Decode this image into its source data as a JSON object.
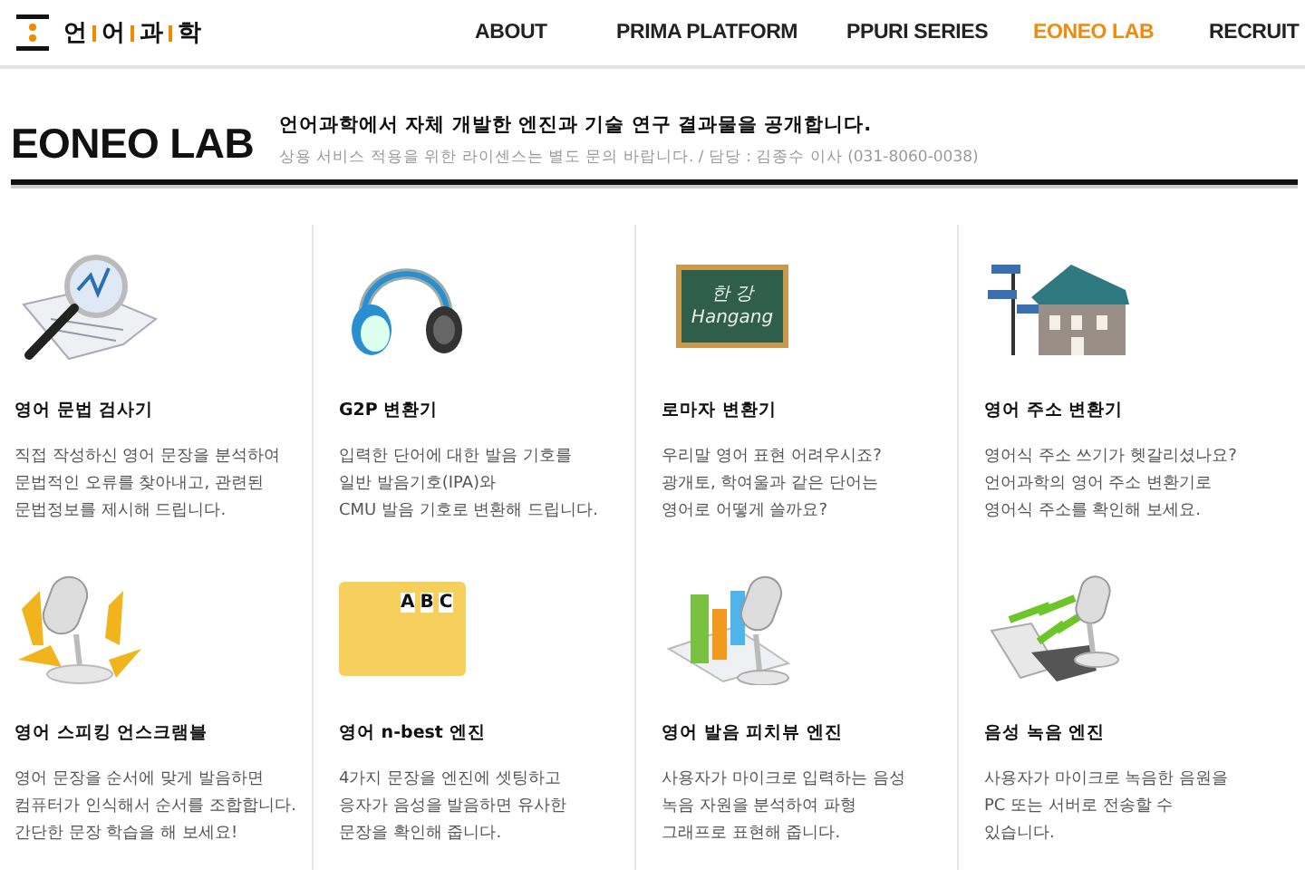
{
  "logo": {
    "syllables": [
      "언",
      "어",
      "과",
      "학"
    ]
  },
  "nav": [
    {
      "label": "ABOUT",
      "selected": false
    },
    {
      "label": "PRIMA PLATFORM",
      "selected": false
    },
    {
      "label": "PPURI SERIES",
      "selected": false
    },
    {
      "label": "EONEO LAB",
      "selected": true
    },
    {
      "label": "RECRUIT",
      "selected": false
    }
  ],
  "page_header": {
    "title": "EONEO LAB",
    "subtitle": "언어과학에서 자체 개발한 엔진과 기술 연구 결과물을 공개합니다.",
    "note": "상용 서비스 적용을 위한 라이센스는 별도 문의 바랍니다. / 담당 : 김종수 이사 (031-8060-0038)"
  },
  "products": [
    {
      "kind": "magnifier",
      "title": "영어 문법 검사기",
      "description": "직접 작성하신 영어 문장을 분석하여\n문법적인 오류를 찾아내고, 관련된\n문법정보를 제시해 드립니다."
    },
    {
      "kind": "headphones",
      "title": "G2P 변환기",
      "description": "입력한 단어에 대한 발음 기호를\n일반 발음기호(IPA)와\nCMU 발음 기호로 변환해 드립니다."
    },
    {
      "kind": "chalkboard",
      "board_text": [
        "한 강",
        "Hangang"
      ],
      "title": "로마자 변환기",
      "description": "우리말 영어 표현 어려우시죠?\n광개토, 학여울과 같은 단어는\n영어로 어떻게 쓸까요?"
    },
    {
      "kind": "house",
      "title": "영어 주소 변환기",
      "description": "영어식 주소 쓰기가 헷갈리셨나요?\n언어과학의 영어 주소 변환기로\n영어식 주소를 확인해 보세요."
    },
    {
      "kind": "mic_arrows",
      "title": "영어 스피킹 언스크램블",
      "description": "영어 문장을 순서에 맞게 발음하면\n컴퓨터가 인식해서 순서를 조합합니다.\n간단한 문장 학습을 해 보세요!"
    },
    {
      "kind": "folder",
      "board_text": [
        "A",
        "B",
        "C"
      ],
      "title": "영어 n-best 엔진",
      "description": "4가지 문장을 엔진에 셋팅하고\n응자가 음성을 발음하면 유사한\n문장을 확인해 줍니다."
    },
    {
      "kind": "chart_mic",
      "title": "영어 발음 피치뷰 엔진",
      "description": "사용자가 마이크로 입력하는 음성\n녹음 자원을 분석하여 파형\n그래프로 표현해 줍니다."
    },
    {
      "kind": "laptop_mic",
      "title": "음성 녹음 엔진",
      "description": "사용자가 마이크로 녹음한 음원을\nPC 또는 서버로 전송할 수\n있습니다."
    }
  ]
}
